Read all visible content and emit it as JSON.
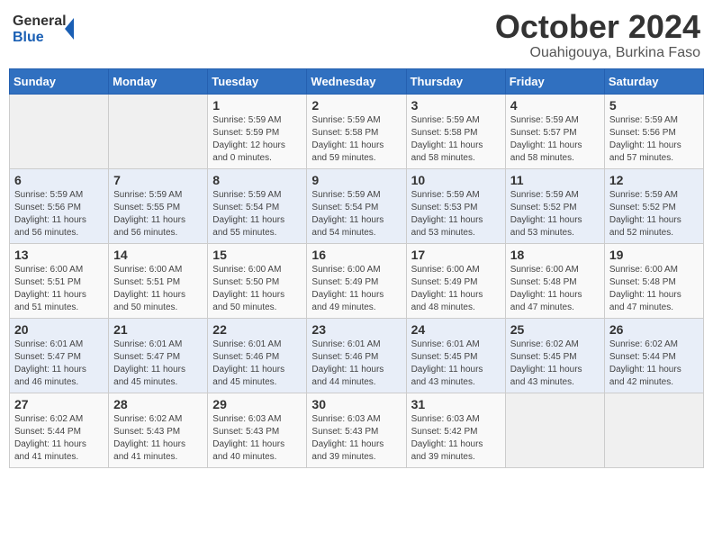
{
  "header": {
    "logo_line1": "General",
    "logo_line2": "Blue",
    "month": "October 2024",
    "location": "Ouahigouya, Burkina Faso"
  },
  "weekdays": [
    "Sunday",
    "Monday",
    "Tuesday",
    "Wednesday",
    "Thursday",
    "Friday",
    "Saturday"
  ],
  "weeks": [
    [
      {
        "day": "",
        "info": ""
      },
      {
        "day": "",
        "info": ""
      },
      {
        "day": "1",
        "info": "Sunrise: 5:59 AM\nSunset: 5:59 PM\nDaylight: 12 hours\nand 0 minutes."
      },
      {
        "day": "2",
        "info": "Sunrise: 5:59 AM\nSunset: 5:58 PM\nDaylight: 11 hours\nand 59 minutes."
      },
      {
        "day": "3",
        "info": "Sunrise: 5:59 AM\nSunset: 5:58 PM\nDaylight: 11 hours\nand 58 minutes."
      },
      {
        "day": "4",
        "info": "Sunrise: 5:59 AM\nSunset: 5:57 PM\nDaylight: 11 hours\nand 58 minutes."
      },
      {
        "day": "5",
        "info": "Sunrise: 5:59 AM\nSunset: 5:56 PM\nDaylight: 11 hours\nand 57 minutes."
      }
    ],
    [
      {
        "day": "6",
        "info": "Sunrise: 5:59 AM\nSunset: 5:56 PM\nDaylight: 11 hours\nand 56 minutes."
      },
      {
        "day": "7",
        "info": "Sunrise: 5:59 AM\nSunset: 5:55 PM\nDaylight: 11 hours\nand 56 minutes."
      },
      {
        "day": "8",
        "info": "Sunrise: 5:59 AM\nSunset: 5:54 PM\nDaylight: 11 hours\nand 55 minutes."
      },
      {
        "day": "9",
        "info": "Sunrise: 5:59 AM\nSunset: 5:54 PM\nDaylight: 11 hours\nand 54 minutes."
      },
      {
        "day": "10",
        "info": "Sunrise: 5:59 AM\nSunset: 5:53 PM\nDaylight: 11 hours\nand 53 minutes."
      },
      {
        "day": "11",
        "info": "Sunrise: 5:59 AM\nSunset: 5:52 PM\nDaylight: 11 hours\nand 53 minutes."
      },
      {
        "day": "12",
        "info": "Sunrise: 5:59 AM\nSunset: 5:52 PM\nDaylight: 11 hours\nand 52 minutes."
      }
    ],
    [
      {
        "day": "13",
        "info": "Sunrise: 6:00 AM\nSunset: 5:51 PM\nDaylight: 11 hours\nand 51 minutes."
      },
      {
        "day": "14",
        "info": "Sunrise: 6:00 AM\nSunset: 5:51 PM\nDaylight: 11 hours\nand 50 minutes."
      },
      {
        "day": "15",
        "info": "Sunrise: 6:00 AM\nSunset: 5:50 PM\nDaylight: 11 hours\nand 50 minutes."
      },
      {
        "day": "16",
        "info": "Sunrise: 6:00 AM\nSunset: 5:49 PM\nDaylight: 11 hours\nand 49 minutes."
      },
      {
        "day": "17",
        "info": "Sunrise: 6:00 AM\nSunset: 5:49 PM\nDaylight: 11 hours\nand 48 minutes."
      },
      {
        "day": "18",
        "info": "Sunrise: 6:00 AM\nSunset: 5:48 PM\nDaylight: 11 hours\nand 47 minutes."
      },
      {
        "day": "19",
        "info": "Sunrise: 6:00 AM\nSunset: 5:48 PM\nDaylight: 11 hours\nand 47 minutes."
      }
    ],
    [
      {
        "day": "20",
        "info": "Sunrise: 6:01 AM\nSunset: 5:47 PM\nDaylight: 11 hours\nand 46 minutes."
      },
      {
        "day": "21",
        "info": "Sunrise: 6:01 AM\nSunset: 5:47 PM\nDaylight: 11 hours\nand 45 minutes."
      },
      {
        "day": "22",
        "info": "Sunrise: 6:01 AM\nSunset: 5:46 PM\nDaylight: 11 hours\nand 45 minutes."
      },
      {
        "day": "23",
        "info": "Sunrise: 6:01 AM\nSunset: 5:46 PM\nDaylight: 11 hours\nand 44 minutes."
      },
      {
        "day": "24",
        "info": "Sunrise: 6:01 AM\nSunset: 5:45 PM\nDaylight: 11 hours\nand 43 minutes."
      },
      {
        "day": "25",
        "info": "Sunrise: 6:02 AM\nSunset: 5:45 PM\nDaylight: 11 hours\nand 43 minutes."
      },
      {
        "day": "26",
        "info": "Sunrise: 6:02 AM\nSunset: 5:44 PM\nDaylight: 11 hours\nand 42 minutes."
      }
    ],
    [
      {
        "day": "27",
        "info": "Sunrise: 6:02 AM\nSunset: 5:44 PM\nDaylight: 11 hours\nand 41 minutes."
      },
      {
        "day": "28",
        "info": "Sunrise: 6:02 AM\nSunset: 5:43 PM\nDaylight: 11 hours\nand 41 minutes."
      },
      {
        "day": "29",
        "info": "Sunrise: 6:03 AM\nSunset: 5:43 PM\nDaylight: 11 hours\nand 40 minutes."
      },
      {
        "day": "30",
        "info": "Sunrise: 6:03 AM\nSunset: 5:43 PM\nDaylight: 11 hours\nand 39 minutes."
      },
      {
        "day": "31",
        "info": "Sunrise: 6:03 AM\nSunset: 5:42 PM\nDaylight: 11 hours\nand 39 minutes."
      },
      {
        "day": "",
        "info": ""
      },
      {
        "day": "",
        "info": ""
      }
    ]
  ]
}
